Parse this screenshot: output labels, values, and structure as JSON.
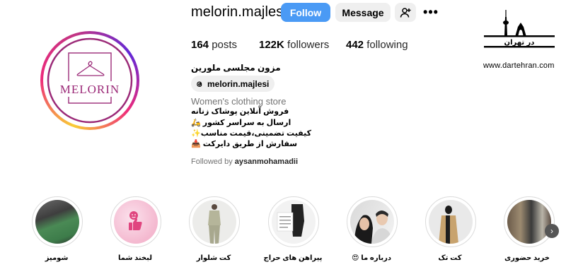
{
  "profile": {
    "username": "melorin.majlesi",
    "follow_label": "Follow",
    "message_label": "Message",
    "posts_count": "164",
    "posts_label": "posts",
    "followers_count": "122K",
    "followers_label": "followers",
    "following_count": "442",
    "following_label": "following",
    "full_name": "مزون مجلسی ملورین",
    "threads_handle": "melorin.majlesi",
    "category": "Women's clothing store",
    "bio": [
      "فروش آنلاین پوشاک زنانه",
      "ارسال به سراسر کشور 🛵",
      "کیفیت تضمینی،قیمت مناسب✨",
      "سفارش از طریق دایرکت 📥"
    ],
    "followed_by_prefix": "Followed by",
    "followed_by_user": "aysanmohamadii",
    "logo_text": "MELORIN"
  },
  "watermark": {
    "title": "در تهران",
    "url": "www.dartehran.com"
  },
  "highlights": [
    {
      "label": "شومیز"
    },
    {
      "label": "لبخند شما"
    },
    {
      "label": "کت شلوار"
    },
    {
      "label": "پیراهن های حراج"
    },
    {
      "label": "درباره ما 😍"
    },
    {
      "label": "کت تک"
    },
    {
      "label": "خرید حضوری"
    }
  ],
  "colors": {
    "follow_button": "#4a9af5",
    "brand_purple": "#9b2a78"
  }
}
